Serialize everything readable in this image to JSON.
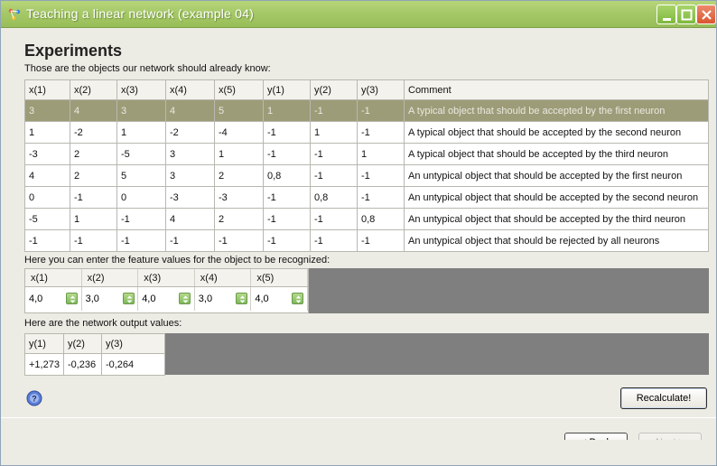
{
  "window": {
    "title": "Teaching a linear network (example 04)"
  },
  "page": {
    "heading": "Experiments",
    "subheading": "Those are the objects our network should already know:"
  },
  "training_table": {
    "headers": [
      "x(1)",
      "x(2)",
      "x(3)",
      "x(4)",
      "x(5)",
      "y(1)",
      "y(2)",
      "y(3)",
      "Comment"
    ],
    "selected_row": 0,
    "rows": [
      [
        "3",
        "4",
        "3",
        "4",
        "5",
        "1",
        "-1",
        "-1",
        "A typical object that should be accepted by the first neuron"
      ],
      [
        "1",
        "-2",
        "1",
        "-2",
        "-4",
        "-1",
        "1",
        "-1",
        "A typical object that should be accepted by the second neuron"
      ],
      [
        "-3",
        "2",
        "-5",
        "3",
        "1",
        "-1",
        "-1",
        "1",
        "A typical object that should be accepted by the third neuron"
      ],
      [
        "4",
        "2",
        "5",
        "3",
        "2",
        "0,8",
        "-1",
        "-1",
        "An untypical object that should be accepted by the first neuron"
      ],
      [
        "0",
        "-1",
        "0",
        "-3",
        "-3",
        "-1",
        "0,8",
        "-1",
        "An untypical object that should be accepted by the second neuron"
      ],
      [
        "-5",
        "1",
        "-1",
        "4",
        "2",
        "-1",
        "-1",
        "0,8",
        "An untypical object that should be accepted by the third neuron"
      ],
      [
        "-1",
        "-1",
        "-1",
        "-1",
        "-1",
        "-1",
        "-1",
        "-1",
        "An untypical object that should be rejected by all neurons"
      ]
    ]
  },
  "features": {
    "label": "Here you can enter the feature values for the object to be recognized:",
    "headers": [
      "x(1)",
      "x(2)",
      "x(3)",
      "x(4)",
      "x(5)"
    ],
    "values": [
      "4,0",
      "3,0",
      "4,0",
      "3,0",
      "4,0"
    ]
  },
  "outputs": {
    "label": "Here are the network output values:",
    "headers": [
      "y(1)",
      "y(2)",
      "y(3)"
    ],
    "values": [
      "+1,273",
      "-0,236",
      "-0,264"
    ]
  },
  "buttons": {
    "recalculate": "Recalculate!",
    "back": "< Back",
    "next": "Next >"
  },
  "colors": {
    "titlebar": "#a6c968",
    "selected_row": "#9d9c78",
    "panel_bg": "#7f7f7f"
  },
  "icons": {
    "app": "network-app-icon",
    "help": "help-icon",
    "stepper": "spin-arrows-icon"
  }
}
